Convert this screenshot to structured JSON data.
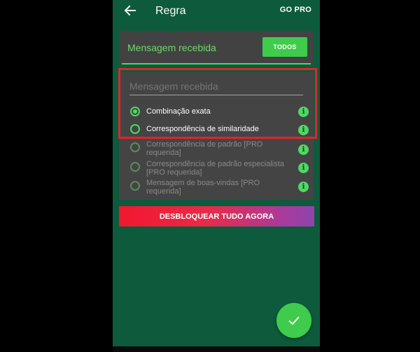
{
  "appbar": {
    "title": "Regra",
    "go_pro": "GO PRO"
  },
  "header": {
    "label": "Mensagem recebida",
    "todos_button": "TODOS"
  },
  "input": {
    "placeholder": "Mensagem recebida"
  },
  "options": [
    {
      "label": "Combinação exata",
      "checked": true,
      "enabled": true
    },
    {
      "label": "Correspondência de similaridade",
      "checked": false,
      "enabled": true
    },
    {
      "label": "Correspondência de padrão [PRO requerida]",
      "checked": false,
      "enabled": false
    },
    {
      "label": "Correspondência de padrão especialista [PRO requerida]",
      "checked": false,
      "enabled": false
    },
    {
      "label": "Mensagem de boas-vindas [PRO requerida]",
      "checked": false,
      "enabled": false
    }
  ],
  "info_icon_glyph": "i",
  "unlock_button": "DESBLOQUEAR TUDO AGORA",
  "colors": {
    "accent": "#4cd964",
    "background": "#0e5a3c",
    "highlight": "#e2242a"
  }
}
